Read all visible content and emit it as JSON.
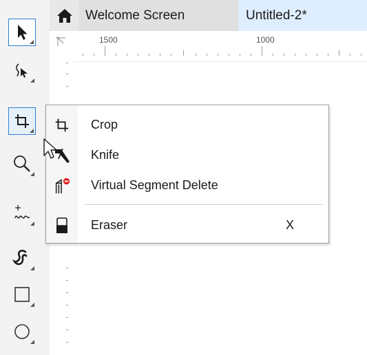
{
  "tabs": [
    {
      "label": "Welcome Screen"
    },
    {
      "label": "Untitled-2*"
    }
  ],
  "ruler": {
    "labels": [
      "1500",
      "1000"
    ]
  },
  "toolbox": {
    "tools": [
      {
        "icon": "pick-arrow-icon"
      },
      {
        "icon": "freehand-pick-icon"
      },
      {
        "icon": "crop-icon",
        "state": "active"
      },
      {
        "icon": "zoom-icon"
      },
      {
        "icon": "freehand-curve-icon"
      },
      {
        "icon": "artistic-media-icon"
      },
      {
        "icon": "rectangle-icon"
      },
      {
        "icon": "ellipse-icon"
      }
    ]
  },
  "flyout_menu": {
    "items": [
      {
        "label": "Crop",
        "icon": "crop-icon",
        "shortcut": ""
      },
      {
        "label": "Knife",
        "icon": "knife-icon",
        "shortcut": ""
      },
      {
        "label": "Virtual Segment Delete",
        "icon": "virtual-segment-delete-icon",
        "shortcut": ""
      },
      {
        "label": "Eraser",
        "icon": "eraser-icon",
        "shortcut": "X"
      }
    ]
  },
  "colors": {
    "accent": "#2a7fd4",
    "active_tab": "#dfeeff",
    "delete_badge": "#e0201b"
  }
}
